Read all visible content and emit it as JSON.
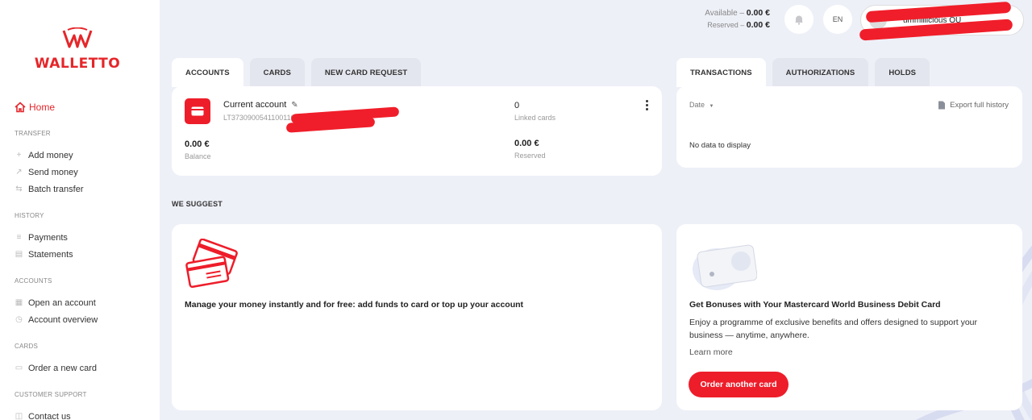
{
  "brand": {
    "name": "WALLETTO",
    "color": "#e5262a"
  },
  "sidebar": {
    "home": {
      "label": "Home",
      "icon": "home-icon"
    },
    "sections": [
      {
        "title": "TRANSFER",
        "items": [
          {
            "label": "Add money",
            "icon": "plus-icon"
          },
          {
            "label": "Send money",
            "icon": "arrow-up-right-icon"
          },
          {
            "label": "Batch transfer",
            "icon": "swap-icon"
          }
        ]
      },
      {
        "title": "HISTORY",
        "items": [
          {
            "label": "Payments",
            "icon": "payments-icon"
          },
          {
            "label": "Statements",
            "icon": "document-icon"
          }
        ]
      },
      {
        "title": "ACCOUNTS",
        "items": [
          {
            "label": "Open an account",
            "icon": "open-account-icon"
          },
          {
            "label": "Account overview",
            "icon": "clock-icon"
          }
        ]
      },
      {
        "title": "CARDS",
        "items": [
          {
            "label": "Order a new card",
            "icon": "card-icon"
          }
        ]
      },
      {
        "title": "CUSTOMER SUPPORT",
        "items": [
          {
            "label": "Contact us",
            "icon": "chat-icon"
          }
        ]
      }
    ]
  },
  "header": {
    "available_label": "Available",
    "available_value": "0.00 €",
    "reserved_label": "Reserved",
    "reserved_value": "0.00 €",
    "language": "EN",
    "user_name": "ummillicious OÜ"
  },
  "accounts_tabs": [
    "ACCOUNTS",
    "CARDS",
    "NEW CARD REQUEST"
  ],
  "account": {
    "name": "Current account",
    "iban": "LT37309005411001103",
    "linked_cards_value": "0",
    "linked_cards_label": "Linked cards",
    "balance_value": "0.00 €",
    "balance_label": "Balance",
    "reserved_value": "0.00 €",
    "reserved_label": "Reserved"
  },
  "transactions_tabs": [
    "TRANSACTIONS",
    "AUTHORIZATIONS",
    "HOLDS"
  ],
  "transactions": {
    "date_filter": "Date",
    "export_label": "Export full history",
    "empty_text": "No data to display"
  },
  "suggest": {
    "title": "WE SUGGEST",
    "card1_text": "Manage your money instantly and for free: add funds to card or top up your account",
    "card2_title": "Get Bonuses with Your Mastercard World Business Debit Card",
    "card2_desc": "Enjoy a programme of exclusive benefits and offers designed to support your business — anytime, anywhere.",
    "card2_link": "Learn more",
    "card2_button": "Order another card"
  },
  "colors": {
    "accent": "#ee1d2a",
    "background": "#eef0f8"
  }
}
